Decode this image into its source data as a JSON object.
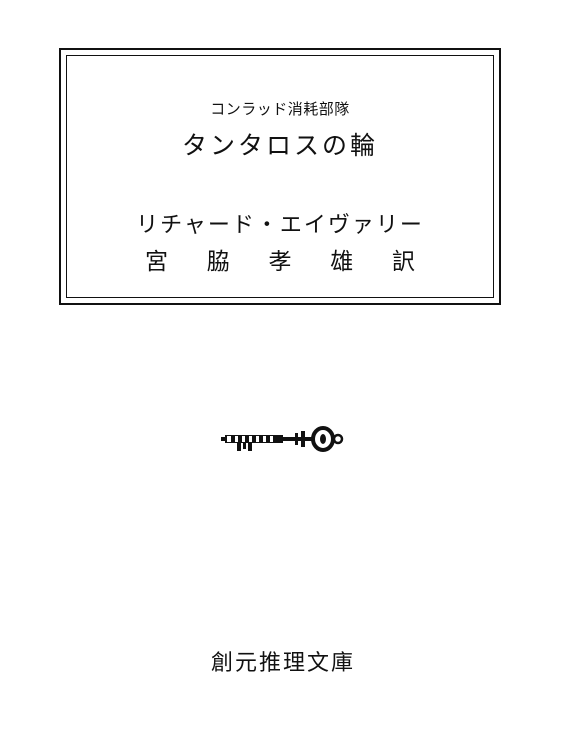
{
  "book": {
    "series": "コンラッド消耗部隊",
    "title": "タンタロスの輪",
    "author": "リチャード・エイヴァリー",
    "translator_chars": [
      "宮",
      "脇",
      "孝",
      "雄",
      "訳"
    ],
    "publisher": "創元推理文庫"
  },
  "icons": {
    "logo": "key-icon"
  }
}
